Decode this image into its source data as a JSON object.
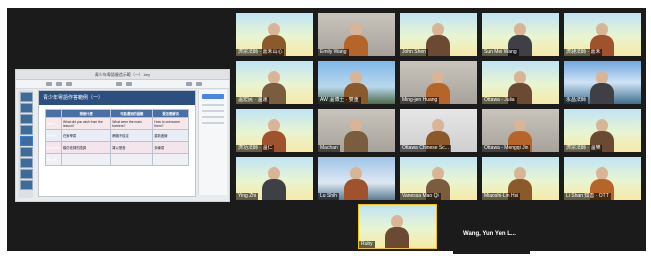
{
  "shared_screen": {
    "window_title": "青少年粵語營造示範（一）.key",
    "slide_title": "青少年粵語作答範例（一）",
    "table": {
      "headers": [
        "",
        "想做什麼",
        "可能遇到的困難",
        "要怎麼解決"
      ],
      "rows": [
        {
          "label": "What",
          "c1": "What did you wish from the lesson?",
          "c2": "What were the main barriers?",
          "c3": "How to overcome them?"
        },
        {
          "label": "Where",
          "c1": "在家學習",
          "c2": "網絡不穩定",
          "c3": "重新連線"
        },
        {
          "label": "Behavior",
          "c1": "模仿老師的語調",
          "c2": "難以發音",
          "c3": "多練習"
        },
        {
          "label": "Result",
          "c1": "",
          "c2": "",
          "c3": ""
        }
      ]
    }
  },
  "participants": [
    {
      "name": "濟宗法師 · 嘉禾山心",
      "style": "cartoon"
    },
    {
      "name": "Emily Wang",
      "style": "office"
    },
    {
      "name": "John Shen",
      "style": "cartoon"
    },
    {
      "name": "Sun Mei Wang",
      "style": "cartoon"
    },
    {
      "name": "濟昶法師 · 嘉禾",
      "style": "cartoon"
    },
    {
      "name": "溫宏民 · 溫運",
      "style": "cartoon"
    },
    {
      "name": "AW 溫博士 · 雙重",
      "style": "sky"
    },
    {
      "name": "Ming-jen Huang",
      "style": "office"
    },
    {
      "name": "Ottawa - Julia",
      "style": "cartoon"
    },
    {
      "name": "永昌法師",
      "style": "lake"
    },
    {
      "name": "濟功法師 · 溫仁",
      "style": "cartoon"
    },
    {
      "name": "Machan",
      "style": "office"
    },
    {
      "name": "Ottawa Chinese Sc...",
      "style": "bunny"
    },
    {
      "name": "Ottawa - Mengqi Jin",
      "style": "office"
    },
    {
      "name": "濟宗法師 · 溫樂",
      "style": "cartoon"
    },
    {
      "name": "Ying Zhi",
      "style": "cartoon"
    },
    {
      "name": "Lu Shih",
      "style": "city"
    },
    {
      "name": "Vanessa Mao Qi",
      "style": "cartoon"
    },
    {
      "name": "Miaoshi-Lin Hsi",
      "style": "cartoon"
    },
    {
      "name": "Li Shan 知善 · OTT",
      "style": "cartoon"
    },
    {
      "name": "Ruby",
      "style": "cartoon"
    }
  ],
  "active_speaker_label": "Wang, Yun Yen L..."
}
